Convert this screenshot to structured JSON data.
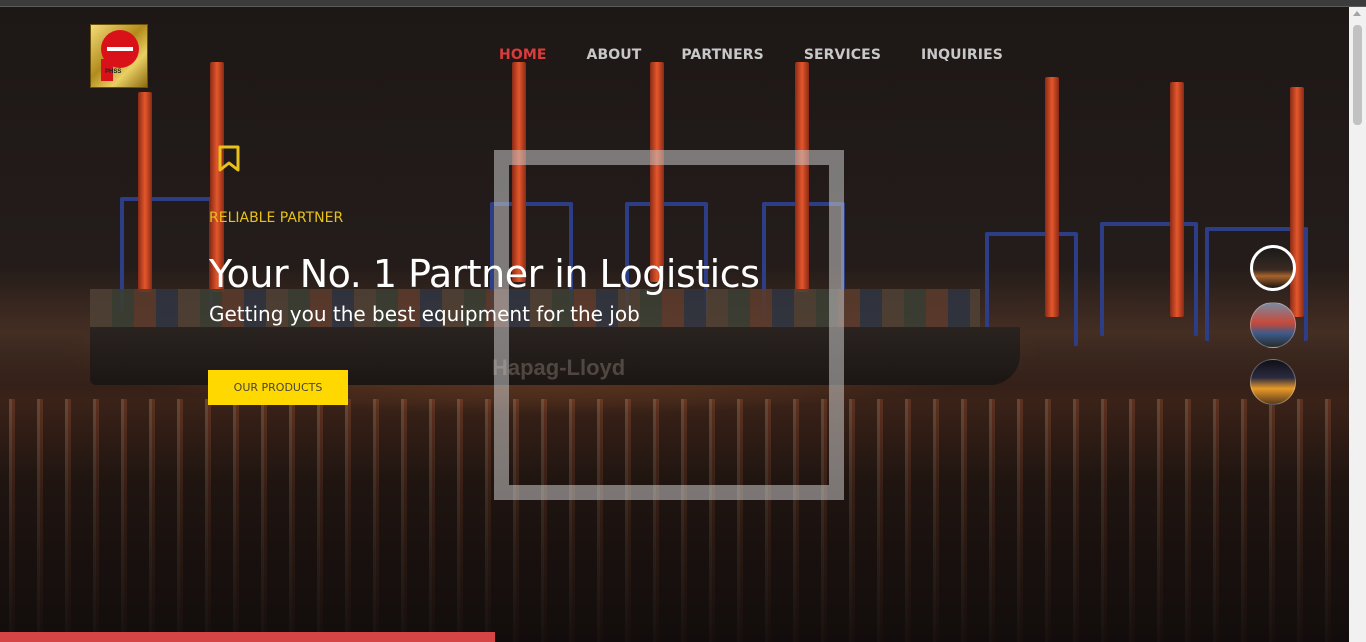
{
  "brand": {
    "logo_text": "PHSS"
  },
  "nav": {
    "items": [
      {
        "label": "HOME",
        "active": true
      },
      {
        "label": "ABOUT",
        "active": false
      },
      {
        "label": "PARTNERS",
        "active": false
      },
      {
        "label": "SERVICES",
        "active": false
      },
      {
        "label": "INQUIRIES",
        "active": false
      }
    ]
  },
  "hero": {
    "eyebrow": "RELIABLE PARTNER",
    "headline": "Your No. 1 Partner in Logistics",
    "subline": "Getting you the best equipment for the job",
    "cta_label": "OUR PRODUCTS",
    "background_text": "Hapag-Lloyd",
    "icon": "bookmark-icon"
  },
  "slider": {
    "slide_count": 3,
    "active_index": 0
  },
  "colors": {
    "accent_red": "#dc3b3b",
    "accent_yellow": "#ffd800",
    "eyebrow_yellow": "#e8c21a",
    "bottom_bar": "#d64545"
  }
}
